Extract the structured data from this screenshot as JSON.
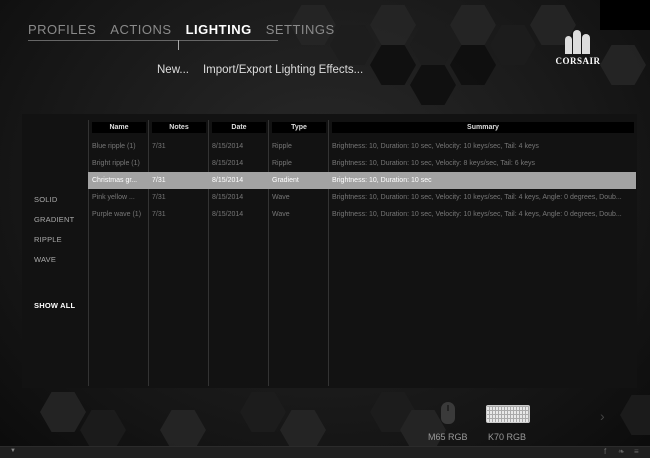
{
  "nav": {
    "tabs": [
      {
        "label": "PROFILES",
        "active": false
      },
      {
        "label": "ACTIONS",
        "active": false
      },
      {
        "label": "LIGHTING",
        "active": true
      },
      {
        "label": "SETTINGS",
        "active": false
      }
    ]
  },
  "subactions": {
    "new_label": "New...",
    "import_export_label": "Import/Export Lighting Effects..."
  },
  "logo": {
    "text": "CORSAIR"
  },
  "filters": {
    "items": [
      "SOLID",
      "GRADIENT",
      "RIPPLE",
      "WAVE"
    ],
    "show_all": "SHOW ALL"
  },
  "table": {
    "headers": [
      "Name",
      "Notes",
      "Date",
      "Type",
      "Summary"
    ],
    "rows": [
      {
        "name": "Blue ripple (1)",
        "notes": "7/31",
        "date": "8/15/2014",
        "type": "Ripple",
        "summary": "Brightness: 10, Duration: 10 sec, Velocity: 10 keys/sec, Tail: 4 keys",
        "selected": false
      },
      {
        "name": "Bright ripple (1)",
        "notes": "",
        "date": "8/15/2014",
        "type": "Ripple",
        "summary": "Brightness: 10, Duration: 10 sec, Velocity: 8 keys/sec, Tail: 6 keys",
        "selected": false
      },
      {
        "name": "Christmas gr...",
        "notes": "7/31",
        "date": "8/15/2014",
        "type": "Gradient",
        "summary": "Brightness: 10, Duration: 10 sec",
        "selected": true
      },
      {
        "name": "Pink yellow ...",
        "notes": "7/31",
        "date": "8/15/2014",
        "type": "Wave",
        "summary": "Brightness: 10, Duration: 10 sec, Velocity: 10 keys/sec, Tail: 4 keys, Angle: 0 degrees, Doub...",
        "selected": false
      },
      {
        "name": "Purple wave (1)",
        "notes": "7/31",
        "date": "8/15/2014",
        "type": "Wave",
        "summary": "Brightness: 10, Duration: 10 sec, Velocity: 10 keys/sec, Tail: 4 keys, Angle: 0 degrees, Doub...",
        "selected": false
      }
    ]
  },
  "devices": [
    {
      "label": "M65 RGB",
      "icon": "mouse-icon"
    },
    {
      "label": "K70 RGB",
      "icon": "keyboard-icon"
    }
  ],
  "colors": {
    "selected_row": "#a3a3a3",
    "background": "#151515"
  }
}
